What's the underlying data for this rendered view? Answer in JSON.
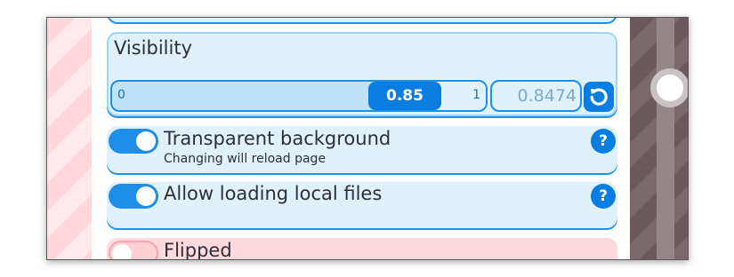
{
  "visibility": {
    "title": "Visibility",
    "slider_min": "0",
    "slider_max": "1",
    "slider_value": "0.85",
    "input_value": "0.8474",
    "reset_icon": "reset-icon"
  },
  "options": [
    {
      "label": "Transparent background",
      "sublabel": "Changing will reload page",
      "enabled": true,
      "help": "?"
    },
    {
      "label": "Allow loading local files",
      "enabled": true,
      "help": "?"
    },
    {
      "label": "Flipped",
      "enabled": false
    }
  ],
  "colors": {
    "accent": "#1e8ee8",
    "card_bg": "#dff1fb",
    "flipped_bg": "#ffd9de"
  }
}
